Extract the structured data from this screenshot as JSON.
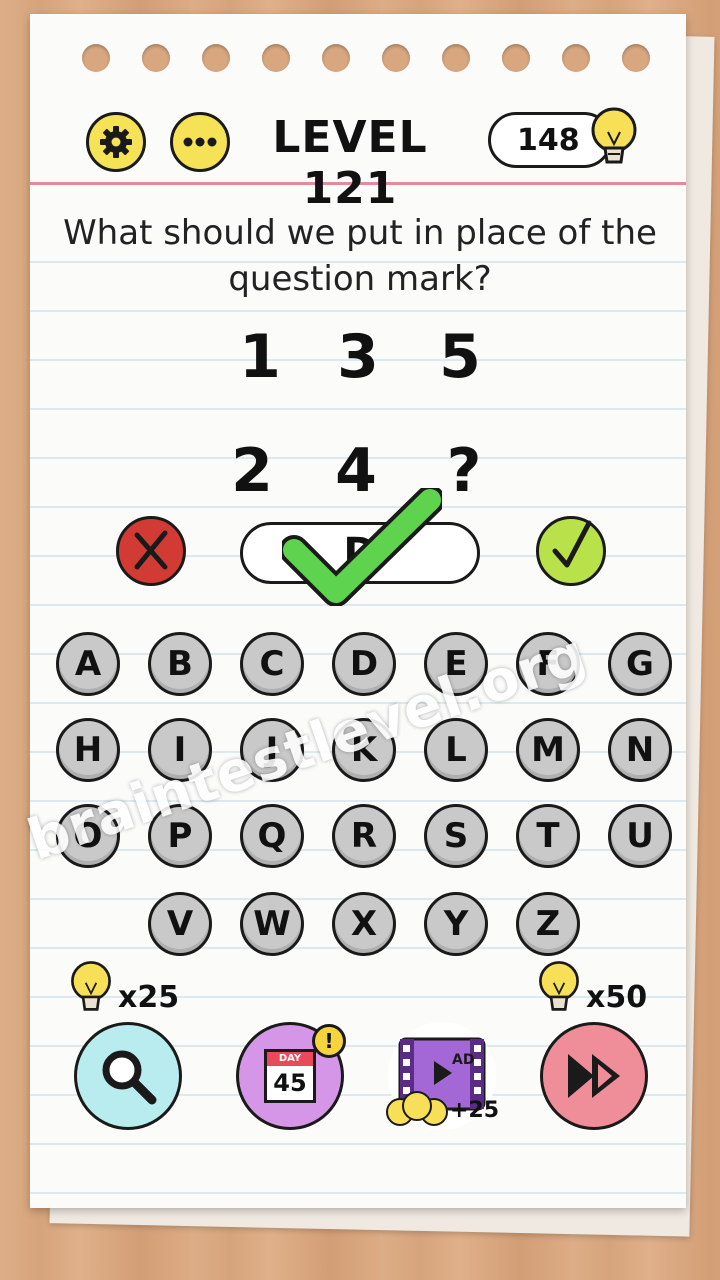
{
  "header": {
    "level_label": "LEVEL 121",
    "coin_count": "148"
  },
  "puzzle": {
    "question": "What should we put in place of the question mark?",
    "row1": [
      "1",
      "3",
      "5"
    ],
    "row2": [
      "2",
      "4",
      "?"
    ]
  },
  "answer": {
    "value": "D"
  },
  "keyboard": {
    "row1": [
      "A",
      "B",
      "C",
      "D",
      "E",
      "F",
      "G"
    ],
    "row2": [
      "H",
      "I",
      "J",
      "K",
      "L",
      "M",
      "N"
    ],
    "row3": [
      "O",
      "P",
      "Q",
      "R",
      "S",
      "T",
      "U"
    ],
    "row4": [
      "V",
      "W",
      "X",
      "Y",
      "Z"
    ]
  },
  "watermark": "braintestlevel.org",
  "actions": {
    "hint_cost": "x25",
    "daily_day_label": "DAY",
    "daily_day": "45",
    "daily_badge": "!",
    "ad_label": "AD",
    "ad_reward": "+25",
    "skip_cost": "x50"
  },
  "colors": {
    "settings_button": "#f6e256",
    "wrong_button": "#d23a34",
    "correct_button": "#b9e24a",
    "hint_button": "#b8ecef",
    "daily_button": "#d696e8",
    "skip_button": "#ef8d98",
    "check_mark": "#5ed34d"
  }
}
